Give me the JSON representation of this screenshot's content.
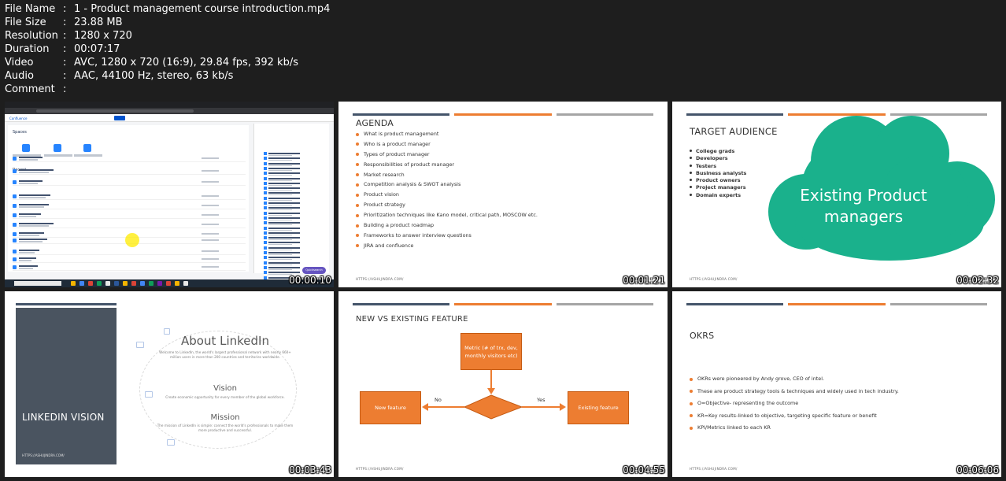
{
  "meta": [
    {
      "label": "File Name",
      "sep": ":",
      "value": "1 - Product management course introduction.mp4"
    },
    {
      "label": "File Size",
      "sep": ":",
      "value": "23.88 MB"
    },
    {
      "label": "Resolution",
      "sep": ":",
      "value": "1280 x 720"
    },
    {
      "label": "Duration",
      "sep": ":",
      "value": "00:07:17"
    },
    {
      "label": "Video",
      "sep": ":",
      "value": "AVC, 1280 x 720 (16:9), 29.84 fps, 392 kb/s"
    },
    {
      "label": "Audio",
      "sep": ":",
      "value": "AAC, 44100 Hz, stereo, 63 kb/s"
    },
    {
      "label": "Comment",
      "sep": ":",
      "value": ""
    }
  ],
  "thumbs": {
    "t1": {
      "timestamp": "00:00:10",
      "nav_brand": "Confluence",
      "spaces_heading": "Spaces",
      "recent_heading": "Recent",
      "quicksearch": "Quicksearch",
      "colors": {
        "accent": "#0052cc",
        "highlight": "#ffeb00"
      }
    },
    "t2": {
      "timestamp": "00:01:21",
      "title": "AGENDA",
      "items": [
        "What is product management",
        "Who is a product manager",
        "Types of product manager",
        "Responsibilities of product manager",
        "Market research",
        "Competition analysis & SWOT analysis",
        "Product vision",
        "Product strategy",
        "Prioritization techniques like Kano model, critical path, MOSCOW etc.",
        "Building a product roadmap",
        "Frameworks to answer interview questions",
        "JIRA and confluence"
      ],
      "footer": "HTTPS://ASHUJINDRA.COM/"
    },
    "t3": {
      "timestamp": "00:02:32",
      "title": "TARGET AUDIENCE",
      "items": [
        "College grads",
        "Developers",
        "Testers",
        "Business analysts",
        "Product owners",
        "Project managers",
        "Domain experts"
      ],
      "cloud_text_1": "Existing Product",
      "cloud_text_2": "managers",
      "footer": "HTTPS://ASHUJINDRA.COM/",
      "colors": {
        "cloud": "#1ab18c"
      }
    },
    "t4": {
      "timestamp": "00:03:43",
      "panel_title": "LINKEDIN VISION",
      "footer": "HTTPS://ASHUJINDRA.COM/",
      "about_heading": "About LinkedIn",
      "about_text_1": "Welcome to LinkedIn, the world's largest professional network with nearly 660+",
      "about_text_2": "million users in more than 200 countries and territories worldwide.",
      "vision_heading": "Vision",
      "vision_text": "Create economic opportunity for every member of the global workforce.",
      "mission_heading": "Mission",
      "mission_text_1": "The mission of LinkedIn is simple: connect the world's professionals to make them",
      "mission_text_2": "more productive and successful."
    },
    "t5": {
      "timestamp": "00:04:55",
      "title": "NEW VS EXISTING FEATURE",
      "metric_box_1": "Metric (# of trx, dev,",
      "metric_box_2": "monthly visitors etc)",
      "left_box": "New feature",
      "right_box": "Existing feature",
      "no_label": "No",
      "yes_label": "Yes",
      "footer": "HTTPS://ASHUJINDRA.COM/",
      "colors": {
        "box": "#ed7d31"
      }
    },
    "t6": {
      "timestamp": "00:06:06",
      "title": "OKRS",
      "items": [
        "OKRs were pioneered by Andy grove, CEO of intel.",
        "These are product strategy tools & techniques and widely used in tech industry.",
        "O=Objective- representing the outcome",
        "KR=Key results-linked to objective, targeting specific feature or benefit",
        "KPI/Metrics linked to each KR"
      ],
      "footer": "HTTPS://ASHUJINDRA.COM/"
    }
  },
  "colors": {
    "background": "#1e1e1e",
    "bar_dark": "#44546a",
    "bar_orange": "#ed7d31",
    "bar_gray": "#a5a5a5"
  }
}
